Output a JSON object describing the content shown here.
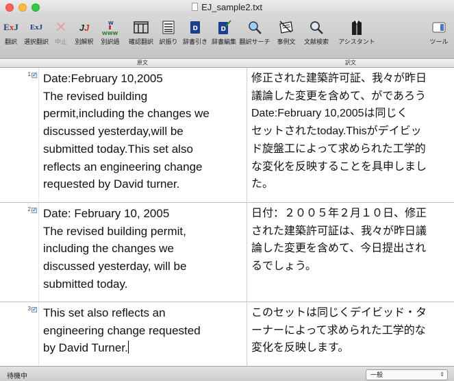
{
  "window": {
    "title": "EJ_sample2.txt"
  },
  "toolbar": {
    "items": [
      {
        "label": "翻訳",
        "icon": "exj-translate-icon",
        "enabled": true
      },
      {
        "label": "選択翻訳",
        "icon": "exj-select-translate-icon",
        "enabled": true
      },
      {
        "label": "中止",
        "icon": "stop-x-icon",
        "enabled": false
      },
      {
        "label": "別解釈",
        "icon": "alt-interpretation-icon",
        "enabled": true
      },
      {
        "label": "別訳語",
        "icon": "alt-term-www-icon",
        "enabled": true
      },
      {
        "label": "確認翻訳",
        "icon": "confirm-translate-icon",
        "enabled": true
      },
      {
        "label": "訳振り",
        "icon": "interlinear-icon",
        "enabled": true
      },
      {
        "label": "辞書引き",
        "icon": "dictionary-lookup-icon",
        "enabled": true
      },
      {
        "label": "辞書編集",
        "icon": "dictionary-edit-icon",
        "enabled": true
      },
      {
        "label": "翻訳サーチ",
        "icon": "translate-search-icon",
        "enabled": true
      },
      {
        "label": "事例文",
        "icon": "example-sentence-icon",
        "enabled": true
      },
      {
        "label": "文献検索",
        "icon": "literature-search-icon",
        "enabled": true
      },
      {
        "label": "アシスタント",
        "icon": "assistant-tuxedo-icon",
        "enabled": true
      },
      {
        "label": "ツール",
        "icon": "tools-icon",
        "enabled": true
      }
    ]
  },
  "columns": {
    "source": "原文",
    "target": "訳文"
  },
  "rows": [
    {
      "num": "1",
      "source": "Date:February 10,2005\nThe revised building\npermit,including the changes we\ndiscussed yesterday,will be\nsubmitted today.This set also\nreflects an engineering change\nrequested by David turner.",
      "target": "修正された建築許可証、我々が昨日\n議論した変更を含めて、がであろう\nDate:February 10,2005は同じく\nセットされたtoday.Thisがデイビッ\nド旋盤工によって求められた工学的\nな変化を反映することを具申しまし\nた。"
    },
    {
      "num": "2",
      "source": "Date: February 10, 2005\nThe revised building permit,\nincluding the changes we\ndiscussed yesterday, will be\nsubmitted today.",
      "target": "日付：２００５年２月１０日、修正\nされた建築許可証は、我々が昨日議\n論した変更を含めて、今日提出され\nるでしょう。"
    },
    {
      "num": "3",
      "source": "This set also reflects an\nengineering change requested\nby David Turner.",
      "target": "このセットは同じくデイビッド・タ\nーナーによって求められた工学的な\n変化を反映します。"
    }
  ],
  "status": {
    "text": "待機中",
    "dictionary": "一般"
  }
}
